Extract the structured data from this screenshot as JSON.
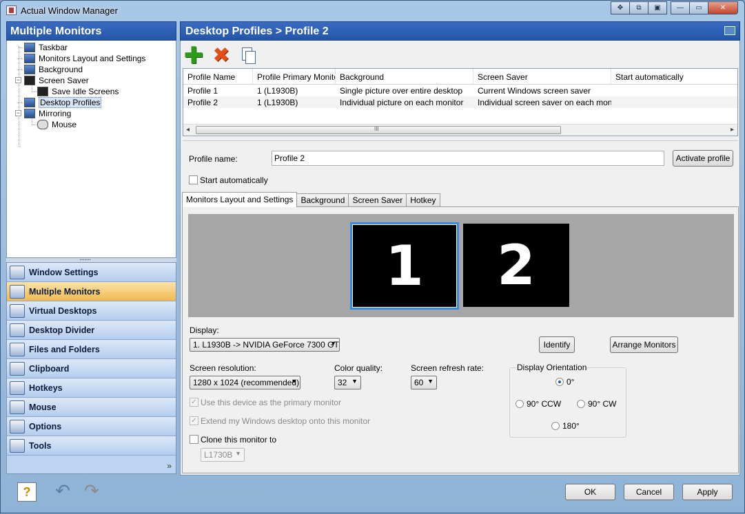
{
  "window": {
    "title": "Actual Window Manager",
    "titlebar_buttons": [
      "✥",
      "⧉",
      "▣",
      "—",
      "▭",
      "✕"
    ]
  },
  "left": {
    "header": "Multiple Monitors",
    "tree": [
      {
        "label": "Taskbar",
        "icon": "taskbar-icon"
      },
      {
        "label": "Monitors Layout and Settings",
        "icon": "monitors-icon"
      },
      {
        "label": "Background",
        "icon": "background-icon"
      },
      {
        "label": "Screen Saver",
        "icon": "screen-saver-icon"
      },
      {
        "label": "Save Idle Screens",
        "icon": "idle-screen-icon"
      },
      {
        "label": "Desktop Profiles",
        "icon": "profiles-icon"
      },
      {
        "label": "Mirroring",
        "icon": "mirroring-icon"
      },
      {
        "label": "Mouse",
        "icon": "mouse-icon"
      }
    ],
    "nav": [
      "Window Settings",
      "Multiple Monitors",
      "Virtual Desktops",
      "Desktop Divider",
      "Files and Folders",
      "Clipboard",
      "Hotkeys",
      "Mouse",
      "Options",
      "Tools"
    ],
    "more": "»"
  },
  "right": {
    "header": "Desktop Profiles > Profile 2",
    "toolbar": {
      "add": "✚",
      "delete": "✖"
    },
    "grid": {
      "columns": [
        "Profile Name",
        "Profile Primary Monitor",
        "Background",
        "Screen Saver",
        "Start automatically"
      ],
      "rows": [
        [
          "Profile 1",
          "1 (L1930B)",
          "Single picture over entire desktop",
          "Current Windows screen saver",
          ""
        ],
        [
          "Profile 2",
          "1 (L1930B)",
          "Individual picture on each monitor",
          "Individual screen saver on each monitor",
          ""
        ]
      ],
      "scroll_left": "◂",
      "scroll_right": "▸"
    },
    "profile_name_label": "Profile name:",
    "profile_name_value": "Profile 2",
    "activate_button": "Activate profile",
    "start_auto_label": "Start automatically",
    "tabs": [
      "Monitors Layout and Settings",
      "Background",
      "Screen Saver",
      "Hotkey"
    ],
    "monitors": [
      "1",
      "2"
    ],
    "display_label": "Display:",
    "display_value": "1. L1930B -> NVIDIA GeForce 7300 GT",
    "identify_button": "Identify",
    "arrange_button": "Arrange Monitors",
    "resolution_label": "Screen resolution:",
    "resolution_value": "1280 x 1024 (recommended)",
    "color_label": "Color quality:",
    "color_value": "32",
    "refresh_label": "Screen refresh rate:",
    "refresh_value": "60",
    "primary_label": "Use this device as the primary monitor",
    "extend_label": "Extend my Windows desktop onto this monitor",
    "clone_label": "Clone this monitor to",
    "clone_value": "L1730B",
    "orientation": {
      "label": "Display Orientation",
      "o0": "0°",
      "o90ccw": "90° CCW",
      "o90cw": "90° CW",
      "o180": "180°"
    }
  },
  "footer": {
    "ok": "OK",
    "cancel": "Cancel",
    "apply": "Apply",
    "help_icon": "?",
    "undo_icon": "↶",
    "redo_icon": "↷"
  }
}
